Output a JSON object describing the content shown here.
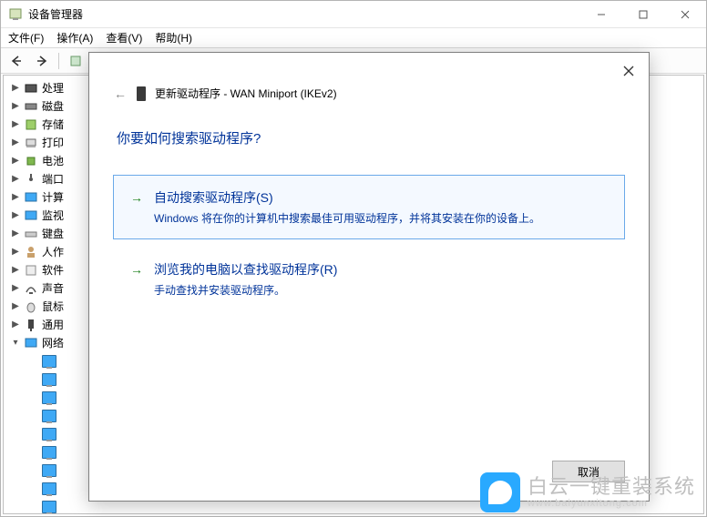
{
  "window": {
    "title": "设备管理器"
  },
  "menu": {
    "file": "文件(F)",
    "action": "操作(A)",
    "view": "查看(V)",
    "help": "帮助(H)"
  },
  "tree": {
    "items": [
      {
        "label": "处理"
      },
      {
        "label": "磁盘"
      },
      {
        "label": "存储"
      },
      {
        "label": "打印"
      },
      {
        "label": "电池"
      },
      {
        "label": "端口"
      },
      {
        "label": "计算"
      },
      {
        "label": "监视"
      },
      {
        "label": "键盘"
      },
      {
        "label": "人作"
      },
      {
        "label": "软件"
      },
      {
        "label": "声音"
      },
      {
        "label": "鼠标"
      },
      {
        "label": "通用"
      }
    ],
    "expanded": {
      "label": "网络"
    },
    "children_count": 9
  },
  "dialog": {
    "crumb": "更新驱动程序 - WAN Miniport (IKEv2)",
    "question": "你要如何搜索驱动程序?",
    "option1": {
      "title": "自动搜索驱动程序(S)",
      "sub": "Windows 将在你的计算机中搜索最佳可用驱动程序，并将其安装在你的设备上。"
    },
    "option2": {
      "title": "浏览我的电脑以查找驱动程序(R)",
      "sub": "手动查找并安装驱动程序。"
    },
    "cancel": "取消"
  },
  "watermark": {
    "main": "白云一键重装系统",
    "sub": "www.baiyunxitong.com"
  }
}
